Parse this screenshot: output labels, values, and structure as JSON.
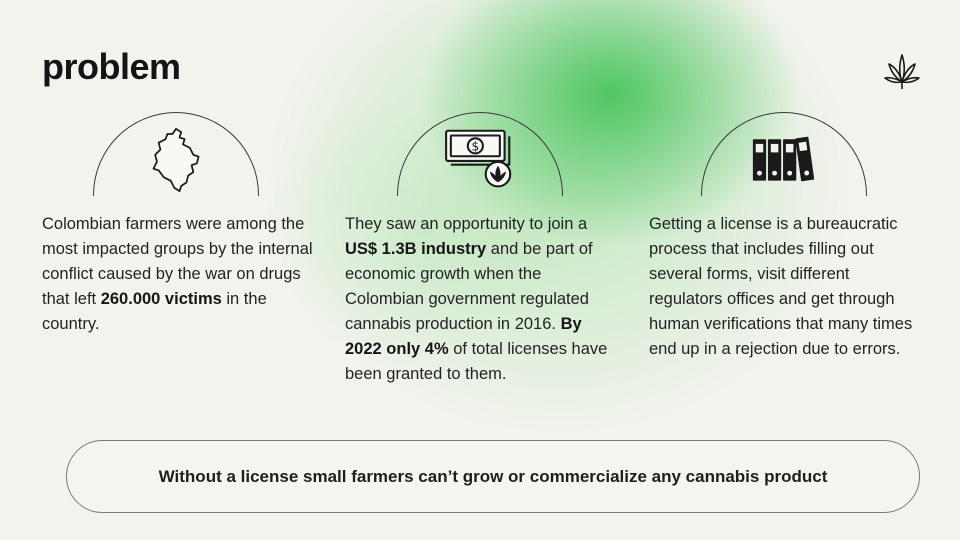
{
  "title": "problem",
  "icons": {
    "brand": "cannabis-leaf-icon",
    "col1": "colombia-map-icon",
    "col2": "money-bill-icon",
    "col3": "binders-icon"
  },
  "columns": [
    {
      "t1": "Colombian farmers were among the most impacted groups by the internal conflict caused by the war on drugs that left ",
      "b1": "260.000 victims",
      "t2": " in the country."
    },
    {
      "t1": "They saw an opportunity to join a ",
      "b1": "US$ 1.3B industry",
      "t2": " and be part of economic growth when the Colombian government regulated cannabis production in 2016. ",
      "b2": "By 2022 only 4%",
      "t3": " of total licenses have been granted to them."
    },
    {
      "t1": "Getting a license is a bureaucratic process that includes filling out several forms, visit different regulators offices and get through human verifications that many times end up in a rejection due to errors."
    }
  ],
  "banner": "Without a license small farmers can’t grow or commercialize any cannabis product",
  "colors": {
    "background": "#f3f3ee",
    "accent_green": "#48c45c",
    "text": "#1e1e1e"
  }
}
